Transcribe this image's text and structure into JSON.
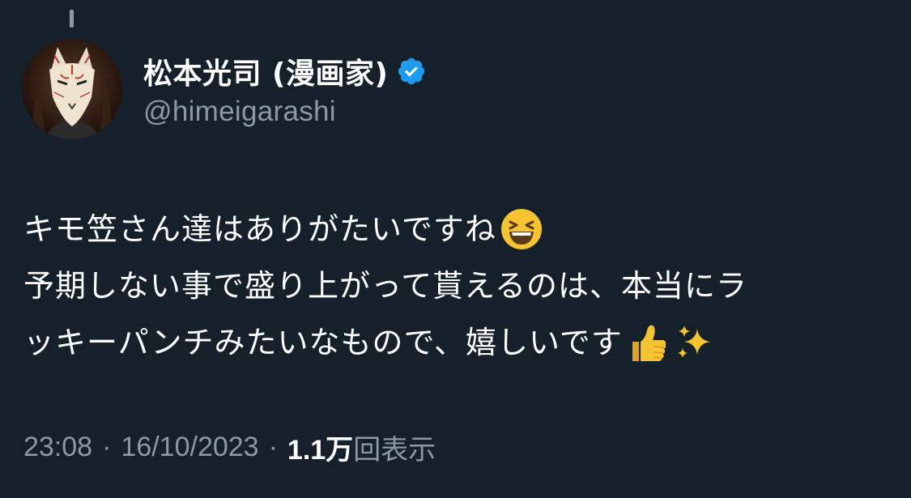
{
  "author": {
    "display_name": "松本光司 (漫画家)",
    "handle": "@himeigarashi",
    "verified": true,
    "avatar": "fox-mask-avatar"
  },
  "tweet": {
    "lines": [
      "キモ笠さん達はありがたいですね",
      "予期しない事で盛り上がって貰えるのは、本当にラ",
      "ッキーパンチみたいなもので、嬉しいです"
    ],
    "emojis": {
      "line1": "grinning-squinting-face-emoji",
      "line3": [
        "thumbs-up-emoji",
        "sparkles-emoji"
      ]
    }
  },
  "meta": {
    "time": "23:08",
    "separator": "·",
    "date": "16/10/2023",
    "views_count": "1.1万",
    "views_label": "回表示"
  },
  "colors": {
    "background": "#15202b",
    "text": "#ffffff",
    "secondary": "#8b98a5",
    "verified": "#1d9bf0"
  }
}
